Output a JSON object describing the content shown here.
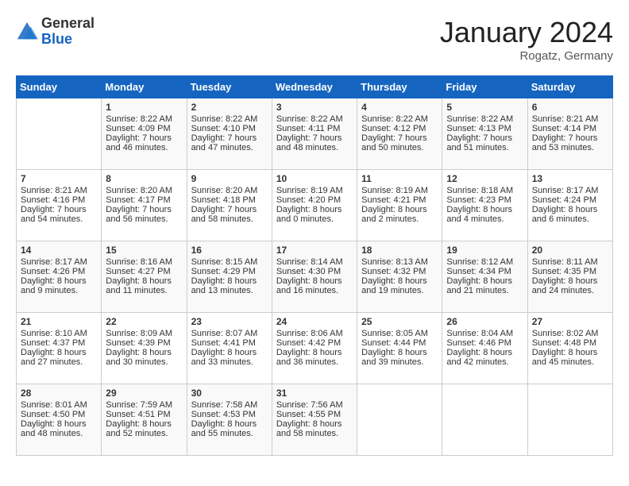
{
  "header": {
    "logo_general": "General",
    "logo_blue": "Blue",
    "month": "January 2024",
    "location": "Rogatz, Germany"
  },
  "weekdays": [
    "Sunday",
    "Monday",
    "Tuesday",
    "Wednesday",
    "Thursday",
    "Friday",
    "Saturday"
  ],
  "weeks": [
    [
      {
        "day": "",
        "sunrise": "",
        "sunset": "",
        "daylight": ""
      },
      {
        "day": "1",
        "sunrise": "Sunrise: 8:22 AM",
        "sunset": "Sunset: 4:09 PM",
        "daylight": "Daylight: 7 hours and 46 minutes."
      },
      {
        "day": "2",
        "sunrise": "Sunrise: 8:22 AM",
        "sunset": "Sunset: 4:10 PM",
        "daylight": "Daylight: 7 hours and 47 minutes."
      },
      {
        "day": "3",
        "sunrise": "Sunrise: 8:22 AM",
        "sunset": "Sunset: 4:11 PM",
        "daylight": "Daylight: 7 hours and 48 minutes."
      },
      {
        "day": "4",
        "sunrise": "Sunrise: 8:22 AM",
        "sunset": "Sunset: 4:12 PM",
        "daylight": "Daylight: 7 hours and 50 minutes."
      },
      {
        "day": "5",
        "sunrise": "Sunrise: 8:22 AM",
        "sunset": "Sunset: 4:13 PM",
        "daylight": "Daylight: 7 hours and 51 minutes."
      },
      {
        "day": "6",
        "sunrise": "Sunrise: 8:21 AM",
        "sunset": "Sunset: 4:14 PM",
        "daylight": "Daylight: 7 hours and 53 minutes."
      }
    ],
    [
      {
        "day": "7",
        "sunrise": "Sunrise: 8:21 AM",
        "sunset": "Sunset: 4:16 PM",
        "daylight": "Daylight: 7 hours and 54 minutes."
      },
      {
        "day": "8",
        "sunrise": "Sunrise: 8:20 AM",
        "sunset": "Sunset: 4:17 PM",
        "daylight": "Daylight: 7 hours and 56 minutes."
      },
      {
        "day": "9",
        "sunrise": "Sunrise: 8:20 AM",
        "sunset": "Sunset: 4:18 PM",
        "daylight": "Daylight: 7 hours and 58 minutes."
      },
      {
        "day": "10",
        "sunrise": "Sunrise: 8:19 AM",
        "sunset": "Sunset: 4:20 PM",
        "daylight": "Daylight: 8 hours and 0 minutes."
      },
      {
        "day": "11",
        "sunrise": "Sunrise: 8:19 AM",
        "sunset": "Sunset: 4:21 PM",
        "daylight": "Daylight: 8 hours and 2 minutes."
      },
      {
        "day": "12",
        "sunrise": "Sunrise: 8:18 AM",
        "sunset": "Sunset: 4:23 PM",
        "daylight": "Daylight: 8 hours and 4 minutes."
      },
      {
        "day": "13",
        "sunrise": "Sunrise: 8:17 AM",
        "sunset": "Sunset: 4:24 PM",
        "daylight": "Daylight: 8 hours and 6 minutes."
      }
    ],
    [
      {
        "day": "14",
        "sunrise": "Sunrise: 8:17 AM",
        "sunset": "Sunset: 4:26 PM",
        "daylight": "Daylight: 8 hours and 9 minutes."
      },
      {
        "day": "15",
        "sunrise": "Sunrise: 8:16 AM",
        "sunset": "Sunset: 4:27 PM",
        "daylight": "Daylight: 8 hours and 11 minutes."
      },
      {
        "day": "16",
        "sunrise": "Sunrise: 8:15 AM",
        "sunset": "Sunset: 4:29 PM",
        "daylight": "Daylight: 8 hours and 13 minutes."
      },
      {
        "day": "17",
        "sunrise": "Sunrise: 8:14 AM",
        "sunset": "Sunset: 4:30 PM",
        "daylight": "Daylight: 8 hours and 16 minutes."
      },
      {
        "day": "18",
        "sunrise": "Sunrise: 8:13 AM",
        "sunset": "Sunset: 4:32 PM",
        "daylight": "Daylight: 8 hours and 19 minutes."
      },
      {
        "day": "19",
        "sunrise": "Sunrise: 8:12 AM",
        "sunset": "Sunset: 4:34 PM",
        "daylight": "Daylight: 8 hours and 21 minutes."
      },
      {
        "day": "20",
        "sunrise": "Sunrise: 8:11 AM",
        "sunset": "Sunset: 4:35 PM",
        "daylight": "Daylight: 8 hours and 24 minutes."
      }
    ],
    [
      {
        "day": "21",
        "sunrise": "Sunrise: 8:10 AM",
        "sunset": "Sunset: 4:37 PM",
        "daylight": "Daylight: 8 hours and 27 minutes."
      },
      {
        "day": "22",
        "sunrise": "Sunrise: 8:09 AM",
        "sunset": "Sunset: 4:39 PM",
        "daylight": "Daylight: 8 hours and 30 minutes."
      },
      {
        "day": "23",
        "sunrise": "Sunrise: 8:07 AM",
        "sunset": "Sunset: 4:41 PM",
        "daylight": "Daylight: 8 hours and 33 minutes."
      },
      {
        "day": "24",
        "sunrise": "Sunrise: 8:06 AM",
        "sunset": "Sunset: 4:42 PM",
        "daylight": "Daylight: 8 hours and 36 minutes."
      },
      {
        "day": "25",
        "sunrise": "Sunrise: 8:05 AM",
        "sunset": "Sunset: 4:44 PM",
        "daylight": "Daylight: 8 hours and 39 minutes."
      },
      {
        "day": "26",
        "sunrise": "Sunrise: 8:04 AM",
        "sunset": "Sunset: 4:46 PM",
        "daylight": "Daylight: 8 hours and 42 minutes."
      },
      {
        "day": "27",
        "sunrise": "Sunrise: 8:02 AM",
        "sunset": "Sunset: 4:48 PM",
        "daylight": "Daylight: 8 hours and 45 minutes."
      }
    ],
    [
      {
        "day": "28",
        "sunrise": "Sunrise: 8:01 AM",
        "sunset": "Sunset: 4:50 PM",
        "daylight": "Daylight: 8 hours and 48 minutes."
      },
      {
        "day": "29",
        "sunrise": "Sunrise: 7:59 AM",
        "sunset": "Sunset: 4:51 PM",
        "daylight": "Daylight: 8 hours and 52 minutes."
      },
      {
        "day": "30",
        "sunrise": "Sunrise: 7:58 AM",
        "sunset": "Sunset: 4:53 PM",
        "daylight": "Daylight: 8 hours and 55 minutes."
      },
      {
        "day": "31",
        "sunrise": "Sunrise: 7:56 AM",
        "sunset": "Sunset: 4:55 PM",
        "daylight": "Daylight: 8 hours and 58 minutes."
      },
      {
        "day": "",
        "sunrise": "",
        "sunset": "",
        "daylight": ""
      },
      {
        "day": "",
        "sunrise": "",
        "sunset": "",
        "daylight": ""
      },
      {
        "day": "",
        "sunrise": "",
        "sunset": "",
        "daylight": ""
      }
    ]
  ]
}
